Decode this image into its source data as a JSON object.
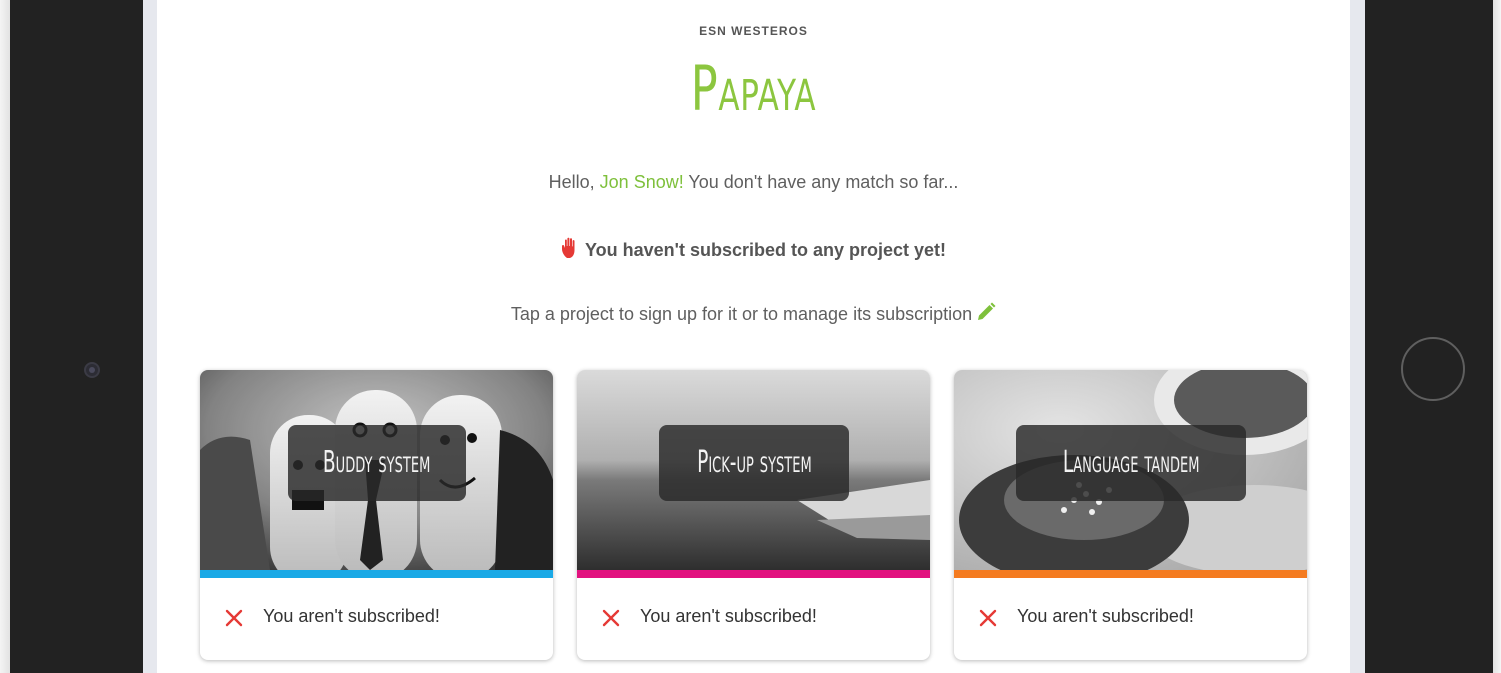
{
  "header": {
    "org_name": "ESN WESTEROS",
    "app_title": "Papaya"
  },
  "greeting": {
    "prefix": "Hello, ",
    "user_name": "Jon Snow!",
    "suffix": " You don't have any match so far..."
  },
  "notice": {
    "icon": "raised-hand-icon",
    "text": "You haven't subscribed to any project yet!"
  },
  "instruction": {
    "text": "Tap a project to sign up for it or to manage its subscription",
    "icon": "pencil-icon"
  },
  "projects": [
    {
      "name": "Buddy system",
      "status": "You aren't subscribed!",
      "accent": "#1aa9e6"
    },
    {
      "name": "Pick-up system",
      "status": "You aren't subscribed!",
      "accent": "#e2127f"
    },
    {
      "name": "Language tandem",
      "status": "You aren't subscribed!",
      "accent": "#f47b20"
    }
  ],
  "colors": {
    "brand_green": "#8cc63f",
    "name_green": "#7ec03b",
    "status_red": "#e53935",
    "hand_red": "#e53935"
  }
}
